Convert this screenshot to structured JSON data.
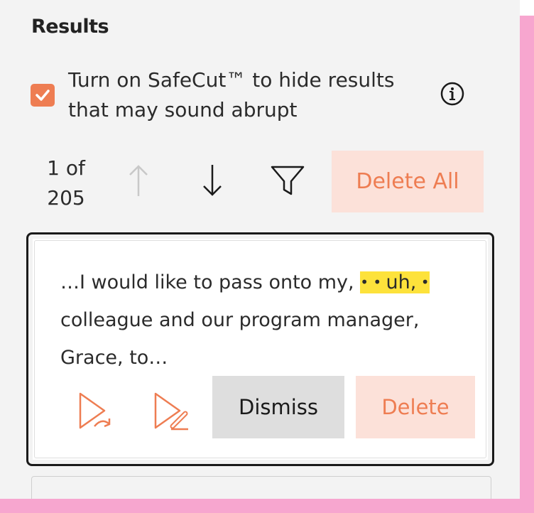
{
  "header": {
    "title": "Results"
  },
  "safecut": {
    "checked": true,
    "label": "Turn on SafeCut™ to hide results that may sound abrupt"
  },
  "nav": {
    "counter_line1": "1 of",
    "counter_line2": "205",
    "delete_all_label": "Delete All"
  },
  "result": {
    "text_before": "…I would like to pass onto my, ",
    "filler_dot_left": "• • ",
    "filler_word": "uh,",
    "filler_dot_right": " •",
    "text_line2": "colleague and our program manager,",
    "text_line3": "Grace, to…",
    "dismiss_label": "Dismiss",
    "delete_label": "Delete"
  },
  "colors": {
    "accent": "#ee7d52",
    "accent_light": "#fce1d9",
    "highlight": "#fde23b",
    "panel_bg": "#f3f3f3",
    "frame": "#f7a6cf"
  },
  "icons": [
    "check-icon",
    "info-icon",
    "arrow-up-icon",
    "arrow-down-icon",
    "filter-icon",
    "play-skip-icon",
    "play-edit-icon"
  ]
}
